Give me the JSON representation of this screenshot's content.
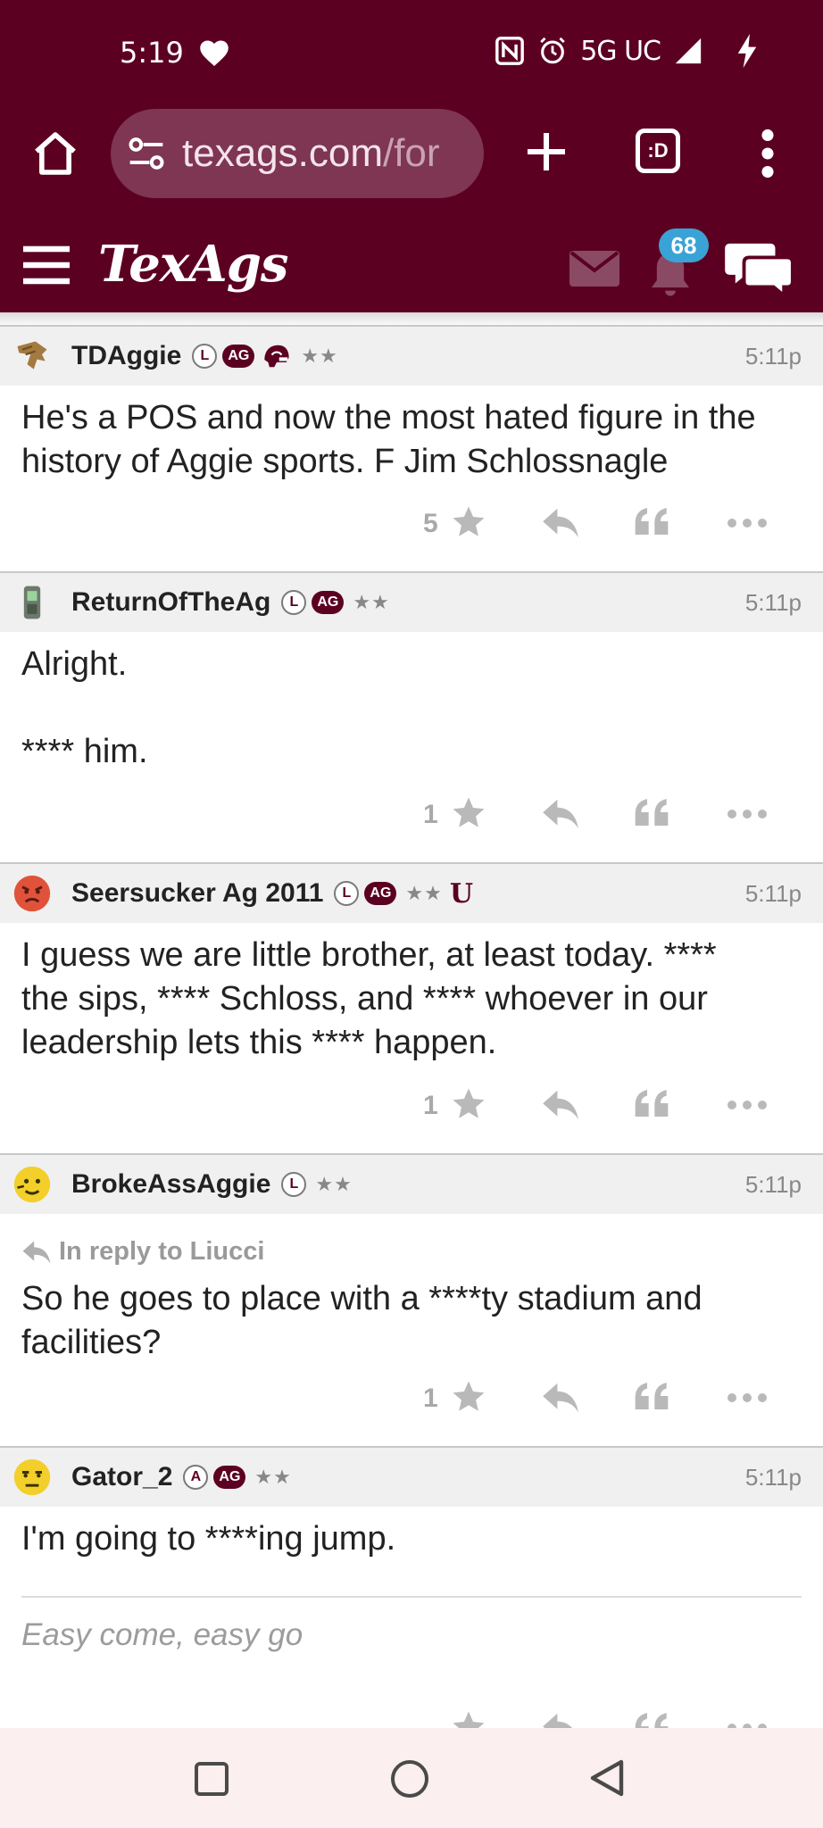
{
  "status_bar": {
    "time": "5:19",
    "network": "5G UC",
    "icons": [
      "heart-icon",
      "nfc-icon",
      "alarm-icon",
      "signal-icon",
      "charging-bolt-icon"
    ]
  },
  "browser": {
    "url_host": "texags.com",
    "url_path": "/for",
    "tabs_label": ":D",
    "icons": [
      "home-icon",
      "site-settings-icon",
      "new-tab-icon",
      "tab-switcher-icon",
      "overflow-menu-icon"
    ]
  },
  "site": {
    "logo": "TexAgs",
    "notification_count": "68",
    "icons": [
      "hamburger-icon",
      "mail-icon",
      "bell-icon",
      "chat-icon"
    ],
    "colors": {
      "maroon": "#5c0022",
      "badge_blue": "#3aa3d6"
    }
  },
  "posts": [
    {
      "username": "TDAggie",
      "badges": [
        "L",
        "AG"
      ],
      "extra_badge": "helmet",
      "stars": "★★",
      "time": "5:11p",
      "body_lines": [
        "He's a POS and now the most hated figure in the",
        "history of Aggie sports. F Jim Schlossnagle"
      ],
      "star_count": "5"
    },
    {
      "username": "ReturnOfTheAg",
      "badges": [
        "L",
        "AG"
      ],
      "stars": "★★",
      "time": "5:11p",
      "body_lines": [
        "Alright.",
        "",
        "**** him."
      ],
      "star_count": "1"
    },
    {
      "username": "Seersucker Ag 2011",
      "badges": [
        "L",
        "AG"
      ],
      "stars": "★★",
      "extra_badge": "U",
      "time": "5:11p",
      "body_lines": [
        "I guess we are little brother, at least today. ****",
        "the sips, **** Schloss, and **** whoever in our",
        "leadership lets this **** happen."
      ],
      "star_count": "1"
    },
    {
      "username": "BrokeAssAggie",
      "badges": [
        "L"
      ],
      "stars": "★★",
      "time": "5:11p",
      "reply_to": "In reply to Liucci",
      "body_lines": [
        "So he goes to place with a ****ty stadium and",
        "facilities?"
      ],
      "star_count": "1"
    },
    {
      "username": "Gator_2",
      "badges": [
        "A",
        "AG"
      ],
      "stars": "★★",
      "time": "5:11p",
      "body_lines": [
        "I'm going to ****ing jump."
      ],
      "signature": "Easy come, easy go"
    }
  ],
  "nav_bar": {
    "icons": [
      "recent-apps-icon",
      "home-circle-icon",
      "back-icon"
    ]
  }
}
